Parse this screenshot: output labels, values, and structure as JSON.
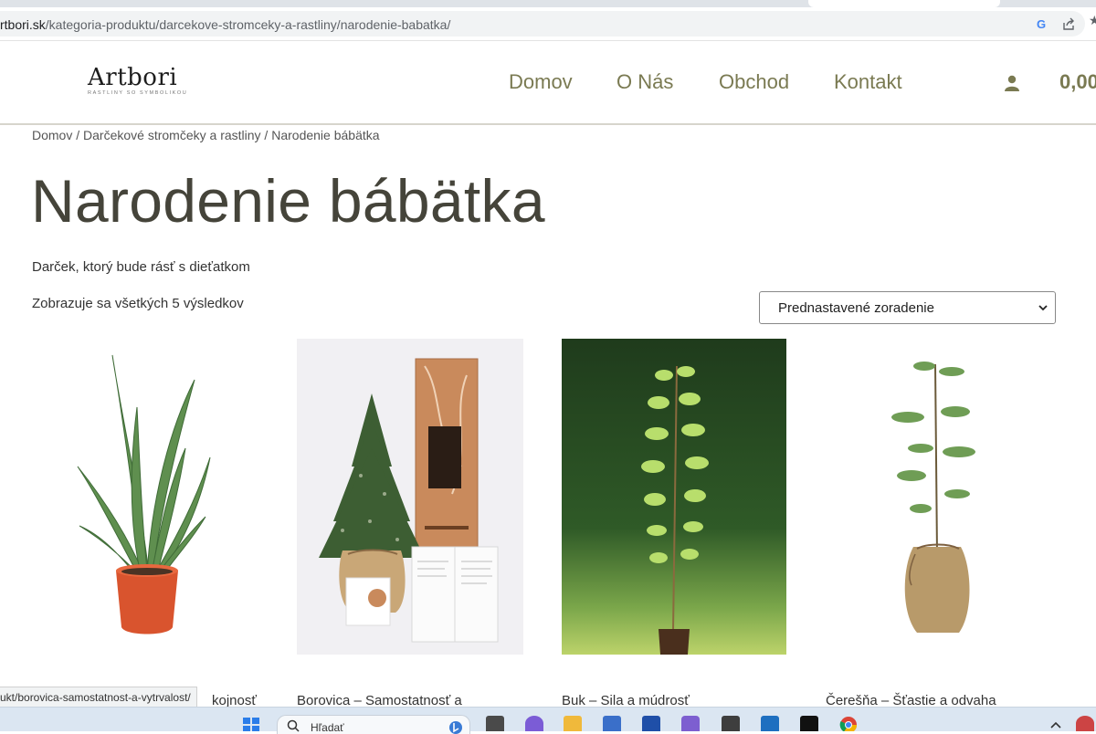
{
  "browser": {
    "url_host": "rtbori.sk",
    "url_path": "/kategoria-produktu/darcekove-stromceky-a-rastliny/narodenie-babatka/",
    "star_glyph": "★"
  },
  "header": {
    "logo_word": "Artbori",
    "logo_tagline": "RASTLINY SO SYMBOLIKOU",
    "nav": [
      {
        "label": "Domov"
      },
      {
        "label": "O Nás"
      },
      {
        "label": "Obchod"
      },
      {
        "label": "Kontakt"
      }
    ],
    "cart_amount": "0,00"
  },
  "breadcrumb": {
    "home": "Domov",
    "sep": " / ",
    "category": "Darčekové stromčeky a rastliny",
    "current": "Narodenie bábätka"
  },
  "page": {
    "title": "Narodenie bábätka",
    "description": "Darček, ktorý bude rásť s dieťatkom",
    "result_count": "Zobrazuje sa všetkých 5 výsledkov",
    "orderby_selected": "Prednastavené zoradenie"
  },
  "products": [
    {
      "title": "kojnosť"
    },
    {
      "title": "Borovica – Samostatnosť a"
    },
    {
      "title": "Buk – Sila a múdrosť"
    },
    {
      "title": "Čerešňa – Šťastie a odvaha"
    }
  ],
  "status_bar": {
    "link_preview": "ukt/borovica-samostatnost-a-vytrvalost/"
  },
  "taskbar": {
    "search_label": "Hľadať"
  },
  "colors": {
    "nav": "#7a7a52",
    "title": "#45443a",
    "header_border": "#d7d5cc"
  }
}
